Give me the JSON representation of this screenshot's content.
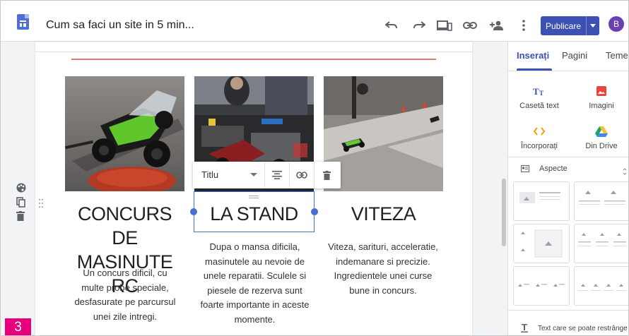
{
  "app": {
    "doc_title": "Cum sa faci un site in 5 min...",
    "publish_label": "Publicare",
    "avatar_initial": "B"
  },
  "toolbar_icons": [
    "undo-icon",
    "redo-icon",
    "preview-devices-icon",
    "link-icon",
    "add-person-icon",
    "more-vert-icon"
  ],
  "content": {
    "columns": [
      {
        "heading": "CONCURS DE MASINUTE RC",
        "body": "Un concurs dificil, cu multe probe speciale, desfasurate pe parcursul unei zile intregi.",
        "image": "rc-car-on-red-cone-photo"
      },
      {
        "heading": "LA STAND",
        "body": "Dupa o mansa dificila, masinutele au nevoie de unele reparatii. Sculele si piesele de rezerva sunt foarte importante in aceste momente.",
        "image": "rc-cars-repair-stand-photo"
      },
      {
        "heading": "VITEZA",
        "body": "Viteza, sarituri, acceleratie, indemanare si precizie. Ingredientele unei curse bune in concurs.",
        "image": "rc-race-track-photo"
      }
    ]
  },
  "format_toolbar": {
    "style_select": "Titlu",
    "buttons": [
      "align-center-icon",
      "link-icon",
      "delete-icon"
    ]
  },
  "left_tools": [
    "palette-icon",
    "duplicate-icon",
    "delete-icon"
  ],
  "panel": {
    "tabs": [
      "Inserați",
      "Pagini",
      "Teme"
    ],
    "active_tab": "Inserați",
    "insert_items": [
      {
        "label": "Casetă text",
        "icon": "text-box-icon"
      },
      {
        "label": "Imagini",
        "icon": "image-icon"
      },
      {
        "label": "Încorporați",
        "icon": "embed-icon"
      },
      {
        "label": "Din Drive",
        "icon": "drive-icon"
      }
    ],
    "aspects_label": "Aspecte",
    "collapsible_label": "Text care se poate restrânge"
  },
  "step_badge": "3",
  "colors": {
    "accent": "#3c51b3",
    "red_line": "#e3786f",
    "selection": "#4a6dcf",
    "step_badge": "#e6007e"
  }
}
